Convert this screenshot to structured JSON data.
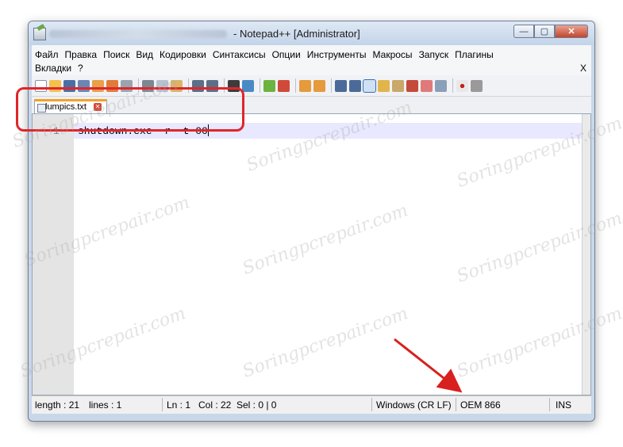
{
  "window": {
    "title": "- Notepad++ [Administrator]",
    "controls": {
      "minimize": "—",
      "maximize": "▢",
      "close": "✕"
    }
  },
  "menu": {
    "row1": [
      "Файл",
      "Правка",
      "Поиск",
      "Вид",
      "Кодировки",
      "Синтаксисы",
      "Опции",
      "Инструменты",
      "Макросы",
      "Запуск",
      "Плагины"
    ],
    "row2": [
      "Вкладки",
      "?"
    ],
    "close_label": "X"
  },
  "toolbar": {
    "icons": [
      "new-file",
      "open-file",
      "save",
      "save-all",
      "close",
      "close-all",
      "print",
      "cut",
      "copy",
      "paste",
      "undo",
      "redo",
      "find",
      "replace",
      "zoom-in",
      "zoom-out",
      "sync-vertical",
      "sync-horizontal",
      "word-wrap",
      "show-all-chars",
      "indent-guide",
      "user-defined-language",
      "doc-map",
      "function-list",
      "folder-as-workspace",
      "monitoring",
      "record-macro",
      "stop-recording"
    ]
  },
  "tab": {
    "label": "lumpics.txt"
  },
  "editor": {
    "line_number": "1",
    "code": "shutdown.exe -r -t 00"
  },
  "status": {
    "length": "length : 21",
    "lines": "lines : 1",
    "ln": "Ln : 1",
    "col": "Col : 22",
    "sel": "Sel : 0 | 0",
    "eol": "Windows (CR LF)",
    "encoding": "OEM 866",
    "mode": "INS"
  },
  "annotation": {
    "highlight_color": "#e0262a",
    "arrow_color": "#d8201e"
  },
  "watermark": "Soringpcrepair.com"
}
